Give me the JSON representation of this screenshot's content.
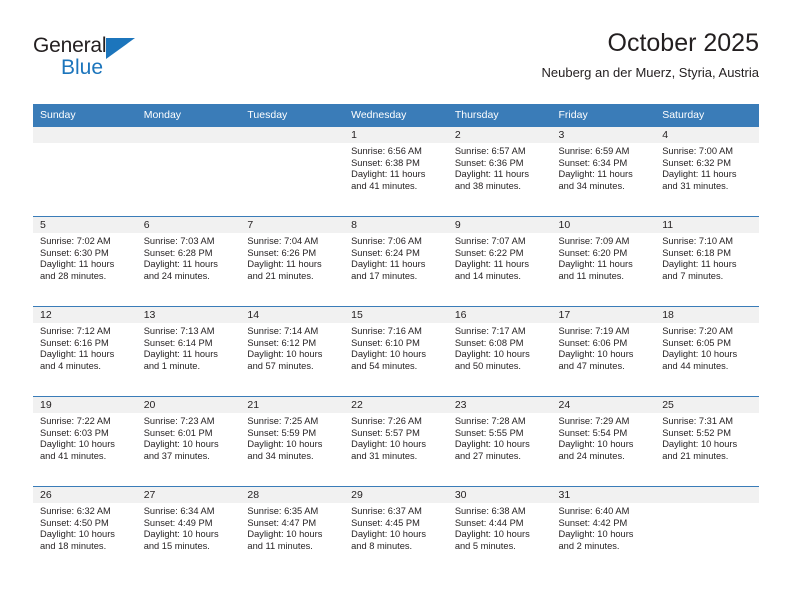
{
  "brand": {
    "word1": "General",
    "word2": "Blue",
    "triangle_icon": "brand-triangle-icon",
    "colors": {
      "blue": "#1c75bc",
      "dark": "#231f20"
    }
  },
  "header": {
    "title": "October 2025",
    "subtitle": "Neuberg an der Muerz, Styria, Austria"
  },
  "theme": {
    "header_blue": "#3a7cb8",
    "daynum_gray": "#f1f1f1",
    "text": "#231f20"
  },
  "weekdays": [
    "Sunday",
    "Monday",
    "Tuesday",
    "Wednesday",
    "Thursday",
    "Friday",
    "Saturday"
  ],
  "labels": {
    "sunrise": "Sunrise:",
    "sunset": "Sunset:",
    "daylight": "Daylight:"
  },
  "weeks": [
    [
      {
        "day": ""
      },
      {
        "day": ""
      },
      {
        "day": ""
      },
      {
        "day": "1",
        "sunrise": "Sunrise: 6:56 AM",
        "sunset": "Sunset: 6:38 PM",
        "daylight_line1": "Daylight: 11 hours",
        "daylight_line2": "and 41 minutes."
      },
      {
        "day": "2",
        "sunrise": "Sunrise: 6:57 AM",
        "sunset": "Sunset: 6:36 PM",
        "daylight_line1": "Daylight: 11 hours",
        "daylight_line2": "and 38 minutes."
      },
      {
        "day": "3",
        "sunrise": "Sunrise: 6:59 AM",
        "sunset": "Sunset: 6:34 PM",
        "daylight_line1": "Daylight: 11 hours",
        "daylight_line2": "and 34 minutes."
      },
      {
        "day": "4",
        "sunrise": "Sunrise: 7:00 AM",
        "sunset": "Sunset: 6:32 PM",
        "daylight_line1": "Daylight: 11 hours",
        "daylight_line2": "and 31 minutes."
      }
    ],
    [
      {
        "day": "5",
        "sunrise": "Sunrise: 7:02 AM",
        "sunset": "Sunset: 6:30 PM",
        "daylight_line1": "Daylight: 11 hours",
        "daylight_line2": "and 28 minutes."
      },
      {
        "day": "6",
        "sunrise": "Sunrise: 7:03 AM",
        "sunset": "Sunset: 6:28 PM",
        "daylight_line1": "Daylight: 11 hours",
        "daylight_line2": "and 24 minutes."
      },
      {
        "day": "7",
        "sunrise": "Sunrise: 7:04 AM",
        "sunset": "Sunset: 6:26 PM",
        "daylight_line1": "Daylight: 11 hours",
        "daylight_line2": "and 21 minutes."
      },
      {
        "day": "8",
        "sunrise": "Sunrise: 7:06 AM",
        "sunset": "Sunset: 6:24 PM",
        "daylight_line1": "Daylight: 11 hours",
        "daylight_line2": "and 17 minutes."
      },
      {
        "day": "9",
        "sunrise": "Sunrise: 7:07 AM",
        "sunset": "Sunset: 6:22 PM",
        "daylight_line1": "Daylight: 11 hours",
        "daylight_line2": "and 14 minutes."
      },
      {
        "day": "10",
        "sunrise": "Sunrise: 7:09 AM",
        "sunset": "Sunset: 6:20 PM",
        "daylight_line1": "Daylight: 11 hours",
        "daylight_line2": "and 11 minutes."
      },
      {
        "day": "11",
        "sunrise": "Sunrise: 7:10 AM",
        "sunset": "Sunset: 6:18 PM",
        "daylight_line1": "Daylight: 11 hours",
        "daylight_line2": "and 7 minutes."
      }
    ],
    [
      {
        "day": "12",
        "sunrise": "Sunrise: 7:12 AM",
        "sunset": "Sunset: 6:16 PM",
        "daylight_line1": "Daylight: 11 hours",
        "daylight_line2": "and 4 minutes."
      },
      {
        "day": "13",
        "sunrise": "Sunrise: 7:13 AM",
        "sunset": "Sunset: 6:14 PM",
        "daylight_line1": "Daylight: 11 hours",
        "daylight_line2": "and 1 minute."
      },
      {
        "day": "14",
        "sunrise": "Sunrise: 7:14 AM",
        "sunset": "Sunset: 6:12 PM",
        "daylight_line1": "Daylight: 10 hours",
        "daylight_line2": "and 57 minutes."
      },
      {
        "day": "15",
        "sunrise": "Sunrise: 7:16 AM",
        "sunset": "Sunset: 6:10 PM",
        "daylight_line1": "Daylight: 10 hours",
        "daylight_line2": "and 54 minutes."
      },
      {
        "day": "16",
        "sunrise": "Sunrise: 7:17 AM",
        "sunset": "Sunset: 6:08 PM",
        "daylight_line1": "Daylight: 10 hours",
        "daylight_line2": "and 50 minutes."
      },
      {
        "day": "17",
        "sunrise": "Sunrise: 7:19 AM",
        "sunset": "Sunset: 6:06 PM",
        "daylight_line1": "Daylight: 10 hours",
        "daylight_line2": "and 47 minutes."
      },
      {
        "day": "18",
        "sunrise": "Sunrise: 7:20 AM",
        "sunset": "Sunset: 6:05 PM",
        "daylight_line1": "Daylight: 10 hours",
        "daylight_line2": "and 44 minutes."
      }
    ],
    [
      {
        "day": "19",
        "sunrise": "Sunrise: 7:22 AM",
        "sunset": "Sunset: 6:03 PM",
        "daylight_line1": "Daylight: 10 hours",
        "daylight_line2": "and 41 minutes."
      },
      {
        "day": "20",
        "sunrise": "Sunrise: 7:23 AM",
        "sunset": "Sunset: 6:01 PM",
        "daylight_line1": "Daylight: 10 hours",
        "daylight_line2": "and 37 minutes."
      },
      {
        "day": "21",
        "sunrise": "Sunrise: 7:25 AM",
        "sunset": "Sunset: 5:59 PM",
        "daylight_line1": "Daylight: 10 hours",
        "daylight_line2": "and 34 minutes."
      },
      {
        "day": "22",
        "sunrise": "Sunrise: 7:26 AM",
        "sunset": "Sunset: 5:57 PM",
        "daylight_line1": "Daylight: 10 hours",
        "daylight_line2": "and 31 minutes."
      },
      {
        "day": "23",
        "sunrise": "Sunrise: 7:28 AM",
        "sunset": "Sunset: 5:55 PM",
        "daylight_line1": "Daylight: 10 hours",
        "daylight_line2": "and 27 minutes."
      },
      {
        "day": "24",
        "sunrise": "Sunrise: 7:29 AM",
        "sunset": "Sunset: 5:54 PM",
        "daylight_line1": "Daylight: 10 hours",
        "daylight_line2": "and 24 minutes."
      },
      {
        "day": "25",
        "sunrise": "Sunrise: 7:31 AM",
        "sunset": "Sunset: 5:52 PM",
        "daylight_line1": "Daylight: 10 hours",
        "daylight_line2": "and 21 minutes."
      }
    ],
    [
      {
        "day": "26",
        "sunrise": "Sunrise: 6:32 AM",
        "sunset": "Sunset: 4:50 PM",
        "daylight_line1": "Daylight: 10 hours",
        "daylight_line2": "and 18 minutes."
      },
      {
        "day": "27",
        "sunrise": "Sunrise: 6:34 AM",
        "sunset": "Sunset: 4:49 PM",
        "daylight_line1": "Daylight: 10 hours",
        "daylight_line2": "and 15 minutes."
      },
      {
        "day": "28",
        "sunrise": "Sunrise: 6:35 AM",
        "sunset": "Sunset: 4:47 PM",
        "daylight_line1": "Daylight: 10 hours",
        "daylight_line2": "and 11 minutes."
      },
      {
        "day": "29",
        "sunrise": "Sunrise: 6:37 AM",
        "sunset": "Sunset: 4:45 PM",
        "daylight_line1": "Daylight: 10 hours",
        "daylight_line2": "and 8 minutes."
      },
      {
        "day": "30",
        "sunrise": "Sunrise: 6:38 AM",
        "sunset": "Sunset: 4:44 PM",
        "daylight_line1": "Daylight: 10 hours",
        "daylight_line2": "and 5 minutes."
      },
      {
        "day": "31",
        "sunrise": "Sunrise: 6:40 AM",
        "sunset": "Sunset: 4:42 PM",
        "daylight_line1": "Daylight: 10 hours",
        "daylight_line2": "and 2 minutes."
      },
      {
        "day": ""
      }
    ]
  ]
}
